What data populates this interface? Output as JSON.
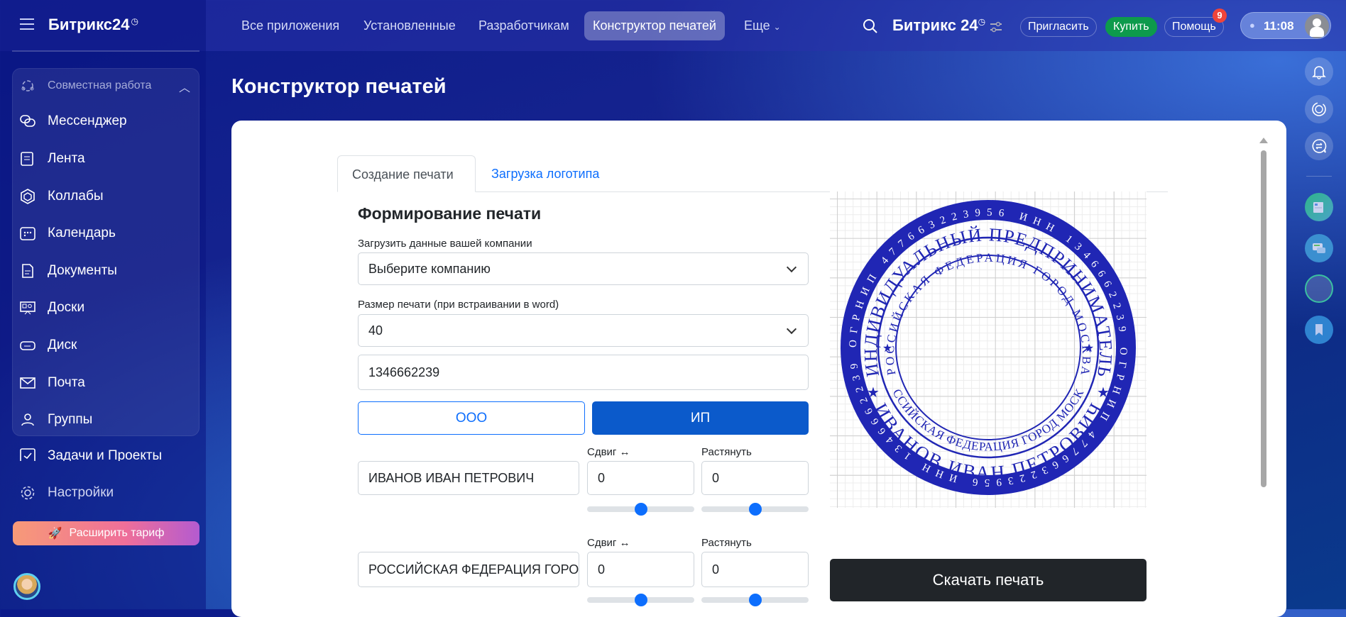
{
  "header": {
    "logo": "Битрикс24",
    "nav": [
      "Все приложения",
      "Установленные",
      "Разработчикам",
      "Конструктор печатей",
      "Еще"
    ],
    "brand": "Битрикс 24",
    "invite": "Пригласить",
    "buy": "Купить",
    "help": "Помощь",
    "help_badge": "9",
    "time": "11:08"
  },
  "sidebar": {
    "group_title": "Совместная работа",
    "items": [
      "Мессенджер",
      "Лента",
      "Коллабы",
      "Календарь",
      "Документы",
      "Доски",
      "Диск",
      "Почта",
      "Группы"
    ],
    "tasks": "Задачи и Проекты",
    "settings": "Настройки",
    "upgrade": "Расширить тариф"
  },
  "page": {
    "title": "Конструктор печатей",
    "tabs": [
      "Создание печати",
      "Загрузка логотипа"
    ],
    "heading": "Формирование печати",
    "company_label": "Загрузить данные вашей компании",
    "company_value": "Выберите компанию",
    "size_label": "Размер печати (при встраивании в word)",
    "size_value": "40",
    "inn_value": "1346662239",
    "type_ooo": "ООО",
    "type_ip": "ИП",
    "rows": [
      {
        "text": "ИВАНОВ ИВАН ПЕТРОВИЧ",
        "shift_label": "Сдвиг ↔",
        "shift": "0",
        "stretch_label": "Растянуть",
        "stretch": "0"
      },
      {
        "text": "РОССИЙСКАЯ ФЕДЕРАЦИЯ ГОРОД МОСКВА",
        "shift_label": "Сдвиг ↔",
        "shift": "0",
        "stretch_label": "Растянуть",
        "stretch": "0"
      }
    ],
    "download": "Скачать печать"
  },
  "stamp": {
    "color": "#2026b4",
    "outer": "ОГРНИП 477663223956   ИНН 1346662239   ОГРНИП 477663223956   ИНН 1346662239",
    "top": "ИНДИВИДУАЛЬНЫЙ ПРЕДПРИНИМАТЕЛЬ",
    "bottom": "ИВАНОВ ИВАН ПЕТРОВИЧ",
    "inner_top": "РОССИЙСКАЯ ФЕДЕРАЦИЯ ГОРОД МОСКВА",
    "inner_bottom": "РОССИЙСКАЯ ФЕДЕРАЦИЯ ГОРОД МОСКВА"
  }
}
